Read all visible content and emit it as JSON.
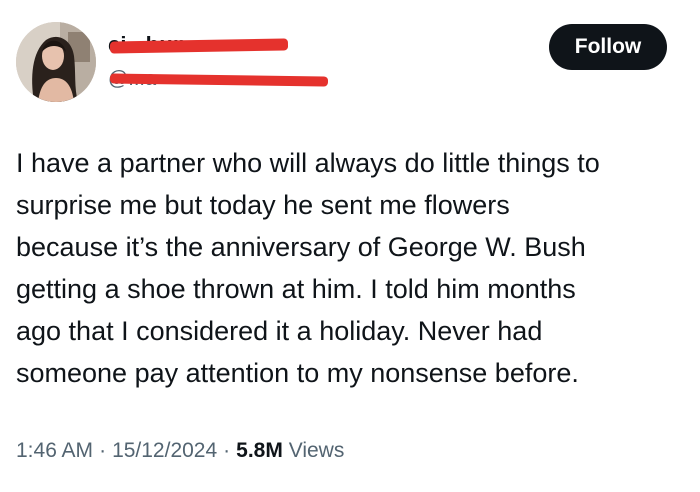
{
  "author": {
    "display_name": "ci...bun",
    "handle": "@...a",
    "redacted": true,
    "redaction_color": "#e5322d"
  },
  "follow_button": {
    "label": "Follow"
  },
  "tweet": {
    "text": "I have a partner who will always do little things to\nsurprise me but today he sent me flowers\nbecause it’s the anniversary of George W. Bush\ngetting a shoe thrown at him. I told him months\nago that I considered it a holiday. Never had\nsomeone pay attention to my nonsense before."
  },
  "meta": {
    "time": "1:46 AM",
    "separator": "·",
    "date": "15/12/2024",
    "views_count": "5.8M",
    "views_label": "Views"
  },
  "colors": {
    "text": "#0f1419",
    "secondary": "#536471",
    "button_bg": "#0f1419"
  }
}
